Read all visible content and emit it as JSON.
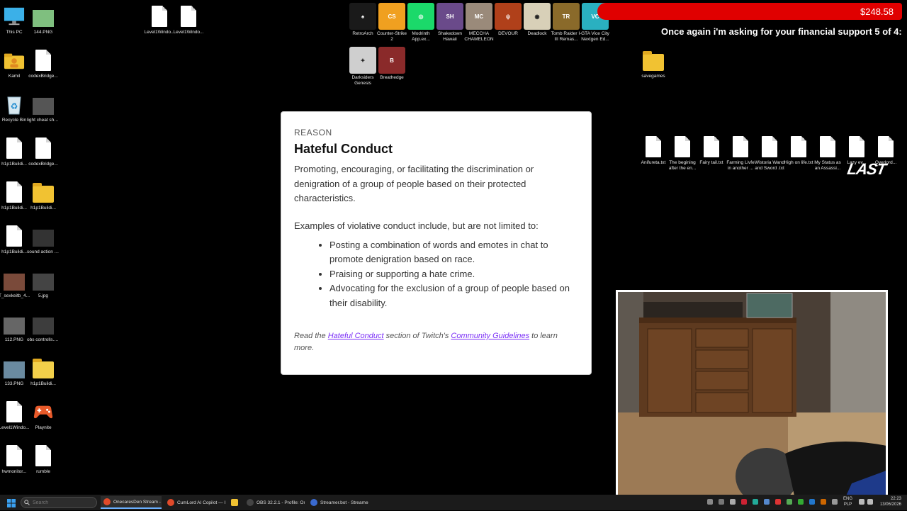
{
  "desktop": {
    "left_icons": [
      {
        "label": "This PC",
        "kind": "monitor"
      },
      {
        "label": "144.PNG",
        "kind": "image",
        "color": "#7fbf7f"
      },
      {
        "label": "Kamil",
        "kind": "user-folder"
      },
      {
        "label": "codexBridge...",
        "kind": "file"
      },
      {
        "label": "Recycle Bin",
        "kind": "recycle"
      },
      {
        "label": "light cheat sheet.webp",
        "kind": "image",
        "color": "#555555"
      },
      {
        "label": "h1p1Buildi...",
        "kind": "file"
      },
      {
        "label": "codexBridge...",
        "kind": "file"
      },
      {
        "label": "h1p1Buildi...",
        "kind": "file"
      },
      {
        "label": "h1p1Buildi...",
        "kind": "folder"
      },
      {
        "label": "h1p1Buildi...",
        "kind": "file"
      },
      {
        "label": "sound action screenshot.jpg",
        "kind": "image",
        "color": "#333333"
      },
      {
        "label": "T_sexkeitb_4...",
        "kind": "image",
        "color": "#7a4a3a"
      },
      {
        "label": "5.jpg",
        "kind": "image",
        "color": "#444444"
      },
      {
        "label": "112.PNG",
        "kind": "image",
        "color": "#666666"
      },
      {
        "label": "obs controlls.jpg",
        "kind": "image",
        "color": "#3d3d3d"
      },
      {
        "label": "133.PNG",
        "kind": "image",
        "color": "#6a8aa0"
      },
      {
        "label": "h1p1Buildi...",
        "kind": "folder-doc"
      },
      {
        "label": "Level1Windo...",
        "kind": "file"
      },
      {
        "label": "Playnite",
        "kind": "gamepad"
      },
      {
        "label": "hwmonitor...",
        "kind": "file"
      },
      {
        "label": "rumble",
        "kind": "file"
      }
    ],
    "top_files": [
      {
        "label": "Level1Windo..."
      },
      {
        "label": "Level1Windo..."
      }
    ],
    "game_icons": [
      {
        "label": "RetroArch",
        "color": "#1a1a1a",
        "glyph": "♠"
      },
      {
        "label": "Counter-Strike 2",
        "color": "#f0a020",
        "glyph": "CS"
      },
      {
        "label": "Modrinth App.ex...",
        "color": "#1bd96a",
        "glyph": "◎"
      },
      {
        "label": "Shakedown Hawaii",
        "color": "#6a4a8a",
        "glyph": "SH"
      },
      {
        "label": "MECCHA CHAMELEON",
        "color": "#9a8a7a",
        "glyph": "MC"
      },
      {
        "label": "DEVOUR",
        "color": "#b0401a",
        "glyph": "ψ"
      },
      {
        "label": "Deadlock",
        "color": "#d8d0b8",
        "glyph": "◉"
      },
      {
        "label": "Tomb Raider I-III Remas...",
        "color": "#8a6a2a",
        "glyph": "TR"
      },
      {
        "label": "GTA Vice City Nextgen Ed...",
        "color": "#2ab0c0",
        "glyph": "VC"
      },
      {
        "label": "Darksiders Genesis",
        "color": "#cfcfcf",
        "glyph": "✦"
      },
      {
        "label": "Breathedge",
        "color": "#8a2a2a",
        "glyph": "B"
      }
    ],
    "savegames_label": "savegames",
    "right_files": [
      "Anifureta.txt",
      "The begining after the en...",
      "Fairy tail.txt",
      "Farming Livfe in another ...",
      "Wistoria Wand and Sword .txt",
      "High on life.txt",
      "My Status as an Assassi...",
      "Lazy ev...",
      "Overlord..."
    ]
  },
  "donation": {
    "amount": "$248.58",
    "message": "Once again i'm asking for your financial support 5 of 4:"
  },
  "policy": {
    "reason_label": "REASON",
    "title": "Hateful Conduct",
    "description": "Promoting, encouraging, or facilitating the discrimination or denigration of a group of people based on their protected characteristics.",
    "intro": "Examples of violative conduct include, but are not limited to:",
    "examples": [
      "Posting a combination of words and emotes in chat to promote denigration based on race.",
      "Praising or supporting a hate crime.",
      "Advocating for the exclusion of a group of people based on their disability."
    ],
    "footer_prefix": "Read the ",
    "footer_link1": "Hateful Conduct",
    "footer_middle": " section of Twitch's ",
    "footer_link2": "Community Guidelines",
    "footer_suffix": " to learn more."
  },
  "overlay_logo": "LAST",
  "taskbar": {
    "search_placeholder": "Search",
    "tasks": [
      {
        "label": "OnecaresDen Stream - Y",
        "color": "#e04a2a"
      },
      {
        "label": "CumLord AI Copilot — I",
        "color": "#e04a2a"
      },
      {
        "label": "",
        "color": "#f1c232"
      },
      {
        "label": "OBS 32.2.1 - Profile: One",
        "color": "#444444"
      },
      {
        "label": "Streamer.bot - Streamer",
        "color": "#3a6ad0"
      }
    ],
    "lang_top": "ENG",
    "lang_bottom": "PLP",
    "time": "22:23",
    "date": "13/06/2026"
  }
}
